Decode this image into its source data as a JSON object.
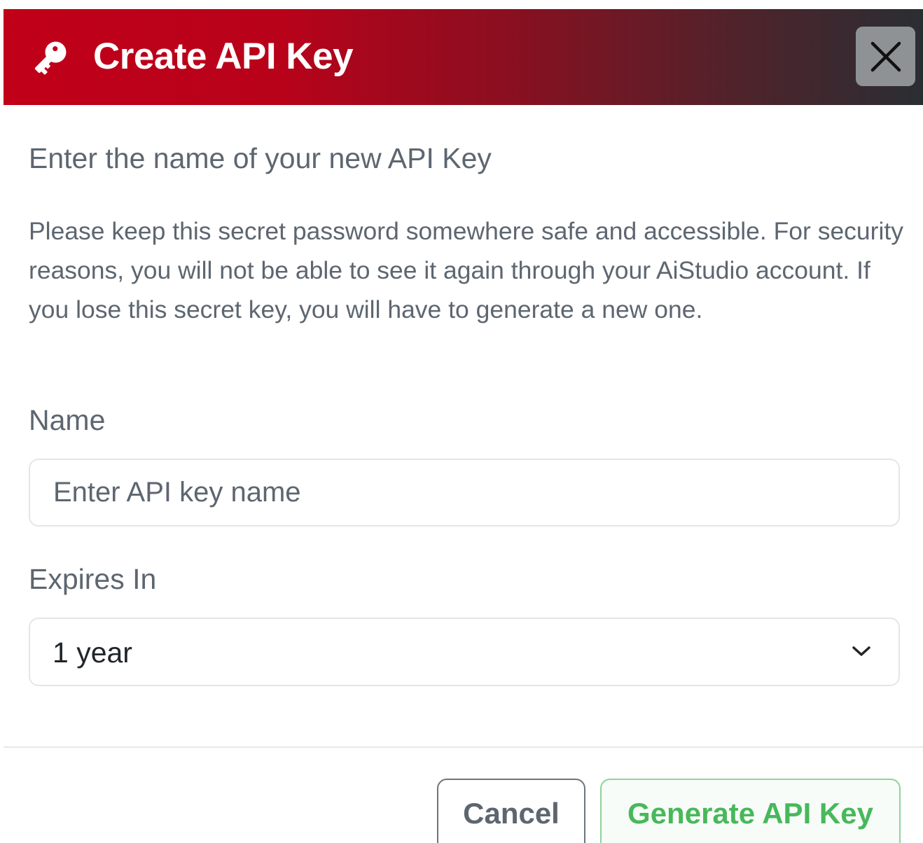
{
  "modal": {
    "title": "Create API Key",
    "header_gradient_colors": [
      "#c10019",
      "#2a2e33"
    ],
    "subtitle": "Enter the name of your new API Key",
    "description": "Please keep this secret password somewhere safe and accessible. For security reasons, you will not be able to see it again through your AiStudio account. If you lose this secret key, you will have to generate a new one.",
    "icons": {
      "title_icon": "key-icon",
      "close_icon": "close-icon",
      "select_icon": "chevron-down-icon"
    }
  },
  "form": {
    "name_label": "Name",
    "name_placeholder": "Enter API key name",
    "name_value": "",
    "expires_label": "Expires In",
    "expires_value": "1 year"
  },
  "footer": {
    "cancel_label": "Cancel",
    "generate_label": "Generate API Key",
    "generate_color": "#48b85b"
  }
}
